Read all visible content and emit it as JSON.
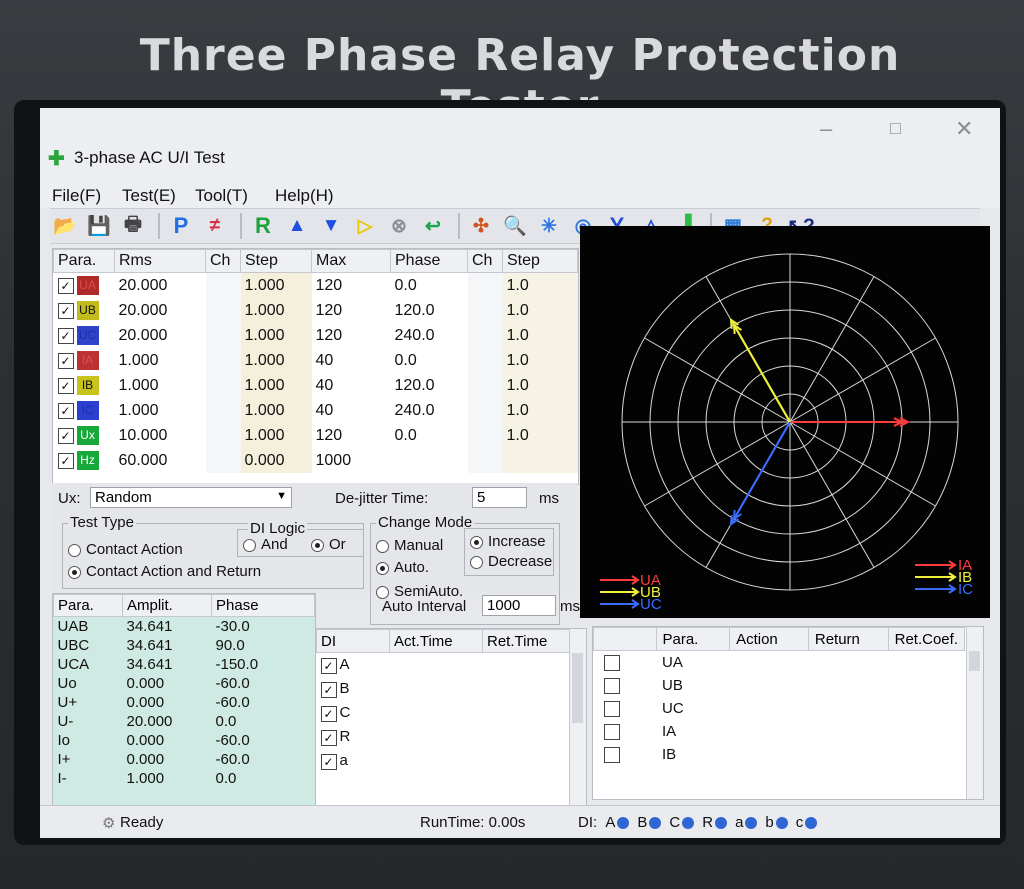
{
  "device": {
    "brand_title": "Three Phase Relay Protection Tester"
  },
  "window": {
    "title": "3-phase AC U/I Test",
    "controls": {
      "minimize": "–",
      "maximize": "□",
      "close": "✕"
    }
  },
  "menu": [
    "File(F)",
    "Test(E)",
    "Tool(T)",
    "Help(H)"
  ],
  "toolbar": {
    "icons": [
      "open-folder-icon",
      "save-icon",
      "print-icon",
      "p-icon",
      "parallel-icon",
      "r-icon",
      "up-arrow-icon",
      "down-arrow-icon",
      "play-icon",
      "stop-icon",
      "return-icon",
      "network-icon",
      "zoom-icon",
      "star-icon",
      "target-icon",
      "wye-icon",
      "delta-icon",
      "bar-chart-icon",
      "calculator-icon",
      "help-icon",
      "context-help-icon"
    ]
  },
  "params": {
    "headers": {
      "para": "Para.",
      "rms": "Rms",
      "ch": "Ch",
      "step": "Step",
      "max": "Max",
      "phase": "Phase",
      "ch2": "Ch",
      "step2": "Step"
    },
    "rows": [
      {
        "name": "UA",
        "color": "#b02a2a",
        "text_color": "#e14a4a",
        "rms": "20.000",
        "step": "1.000",
        "max": "120",
        "phase": "0.0",
        "step2": "1.0"
      },
      {
        "name": "UB",
        "color": "#c3bb1d",
        "text_color": "#111111",
        "rms": "20.000",
        "step": "1.000",
        "max": "120",
        "phase": "120.0",
        "step2": "1.0"
      },
      {
        "name": "UC",
        "color": "#2e43c9",
        "text_color": "#1f2fa5",
        "rms": "20.000",
        "step": "1.000",
        "max": "120",
        "phase": "240.0",
        "step2": "1.0"
      },
      {
        "name": "IA",
        "color": "#bc3232",
        "text_color": "#e14a4a",
        "rms": "1.000",
        "step": "1.000",
        "max": "40",
        "phase": "0.0",
        "step2": "1.0"
      },
      {
        "name": "IB",
        "color": "#c8c21d",
        "text_color": "#111111",
        "rms": "1.000",
        "step": "1.000",
        "max": "40",
        "phase": "120.0",
        "step2": "1.0"
      },
      {
        "name": "IC",
        "color": "#2c3fd0",
        "text_color": "#1f2fa5",
        "rms": "1.000",
        "step": "1.000",
        "max": "40",
        "phase": "240.0",
        "step2": "1.0"
      },
      {
        "name": "Ux",
        "color": "#17a83a",
        "text_color": "#ffffff",
        "rms": "10.000",
        "step": "1.000",
        "max": "120",
        "phase": "0.0",
        "step2": "1.0"
      },
      {
        "name": "Hz",
        "color": "#17a83a",
        "text_color": "#ffffff",
        "rms": "60.000",
        "step": "0.000",
        "max": "1000",
        "phase": "",
        "step2": ""
      }
    ]
  },
  "controls": {
    "ux_label": "Ux:",
    "ux_value": "Random",
    "dejitter_label": "De-jitter Time:",
    "dejitter_value": "5",
    "dejitter_unit": "ms",
    "test_type_label": "Test Type",
    "contact_action": "Contact Action",
    "contact_action_return": "Contact Action and Return",
    "di_logic_label": "DI Logic",
    "and": "And",
    "or": "Or",
    "change_mode_label": "Change Mode",
    "manual": "Manual",
    "auto": "Auto.",
    "semiauto": "SemiAuto.",
    "increase": "Increase",
    "decrease": "Decrease",
    "auto_interval_label": "Auto Interval",
    "auto_interval_value": "1000",
    "auto_interval_unit": "ms"
  },
  "derived": {
    "headers": {
      "para": "Para.",
      "amplit": "Amplit.",
      "phase": "Phase"
    },
    "rows": [
      {
        "para": "UAB",
        "amplit": "34.641",
        "phase": "-30.0"
      },
      {
        "para": "UBC",
        "amplit": "34.641",
        "phase": "90.0"
      },
      {
        "para": "UCA",
        "amplit": "34.641",
        "phase": "-150.0"
      },
      {
        "para": "Uo",
        "amplit": "0.000",
        "phase": "-60.0"
      },
      {
        "para": "U+",
        "amplit": "0.000",
        "phase": "-60.0"
      },
      {
        "para": "U-",
        "amplit": "20.000",
        "phase": "0.0"
      },
      {
        "para": "Io",
        "amplit": "0.000",
        "phase": "-60.0"
      },
      {
        "para": "I+",
        "amplit": "0.000",
        "phase": "-60.0"
      },
      {
        "para": "I-",
        "amplit": "1.000",
        "phase": "0.0"
      }
    ]
  },
  "di_table": {
    "headers": {
      "di": "DI",
      "act": "Act.Time",
      "ret": "Ret.Time"
    },
    "rows": [
      "A",
      "B",
      "C",
      "R",
      "a"
    ]
  },
  "result_table": {
    "headers": {
      "para": "Para.",
      "action": "Action",
      "return": "Return",
      "retcoef": "Ret.Coef."
    },
    "rows": [
      "UA",
      "UB",
      "UC",
      "IA",
      "IB"
    ]
  },
  "vector_legend": {
    "voltage": [
      {
        "label": "UA",
        "color": "#ff3b3b"
      },
      {
        "label": "UB",
        "color": "#f0f03a"
      },
      {
        "label": "UC",
        "color": "#3a6bff"
      }
    ],
    "current": [
      {
        "label": "IA",
        "color": "#ff3b3b"
      },
      {
        "label": "IB",
        "color": "#f0f03a"
      },
      {
        "label": "IC",
        "color": "#3a6bff"
      }
    ]
  },
  "status": {
    "ready": "Ready",
    "runtime": "RunTime: 0.00s",
    "di_label": "DI:",
    "di_items": [
      "A",
      "B",
      "C",
      "R",
      "a",
      "b",
      "c"
    ]
  }
}
